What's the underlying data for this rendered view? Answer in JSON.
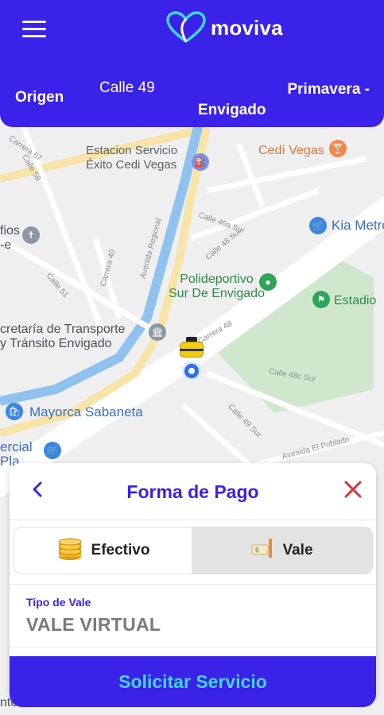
{
  "app": {
    "brand_name": "moviva",
    "brand_color": "#3a22e8",
    "accent_color": "#42d6e0"
  },
  "header": {
    "menu_icon": "hamburger-menu-icon",
    "logo_icon": "moviva-heart-logo-icon"
  },
  "route": {
    "origin_label": "Origen",
    "origin_street": "Calle 49",
    "origin_area_line1": "Primavera -",
    "origin_area_line2": "Envigado"
  },
  "map": {
    "places": {
      "station": "Estacion Servicio\nÉxito Cedi Vegas",
      "cedi_vegas": "Cedí Vegas",
      "kia": "Kia Metro",
      "polideportivo": "Polideportivo\nSur De Envigado",
      "estadio": "Estadio",
      "secretaria": "cretaría de Transporte\ny Tránsito Envigado",
      "mayorca": "Mayorca Sabaneta",
      "comercial": "ercial\nPla",
      "fios": "fios\n-e",
      "ntos": "ntos"
    },
    "streets": {
      "carrera_57": "Carrera 57",
      "calle_58": "Calle 58",
      "calle_46a_sur": "Calle 46a Sur",
      "calle_48_sur": "Calle 48 Sur",
      "avenida_regional": "Avenida Regional",
      "carrera_40": "Carrera 40",
      "calle_51": "Calle 51",
      "carrera_48": "Carrera 48",
      "calle_48c_sur": "Calle 48c Sur",
      "calle_49_sur": "Calle 49 Sur",
      "avenida_poblado": "Avenida El Poblado"
    }
  },
  "payment": {
    "title": "Forma de Pago",
    "back_icon": "chevron-left-icon",
    "close_icon": "close-x-icon",
    "tabs": [
      {
        "label": "Efectivo",
        "icon": "coins-icon",
        "selected": false
      },
      {
        "label": "Vale",
        "icon": "voucher-ticket-icon",
        "selected": true
      }
    ],
    "voucher_type_label": "Tipo de Vale",
    "voucher_type_value": "VALE VIRTUAL",
    "submit_label": "Solicitar Servicio"
  }
}
